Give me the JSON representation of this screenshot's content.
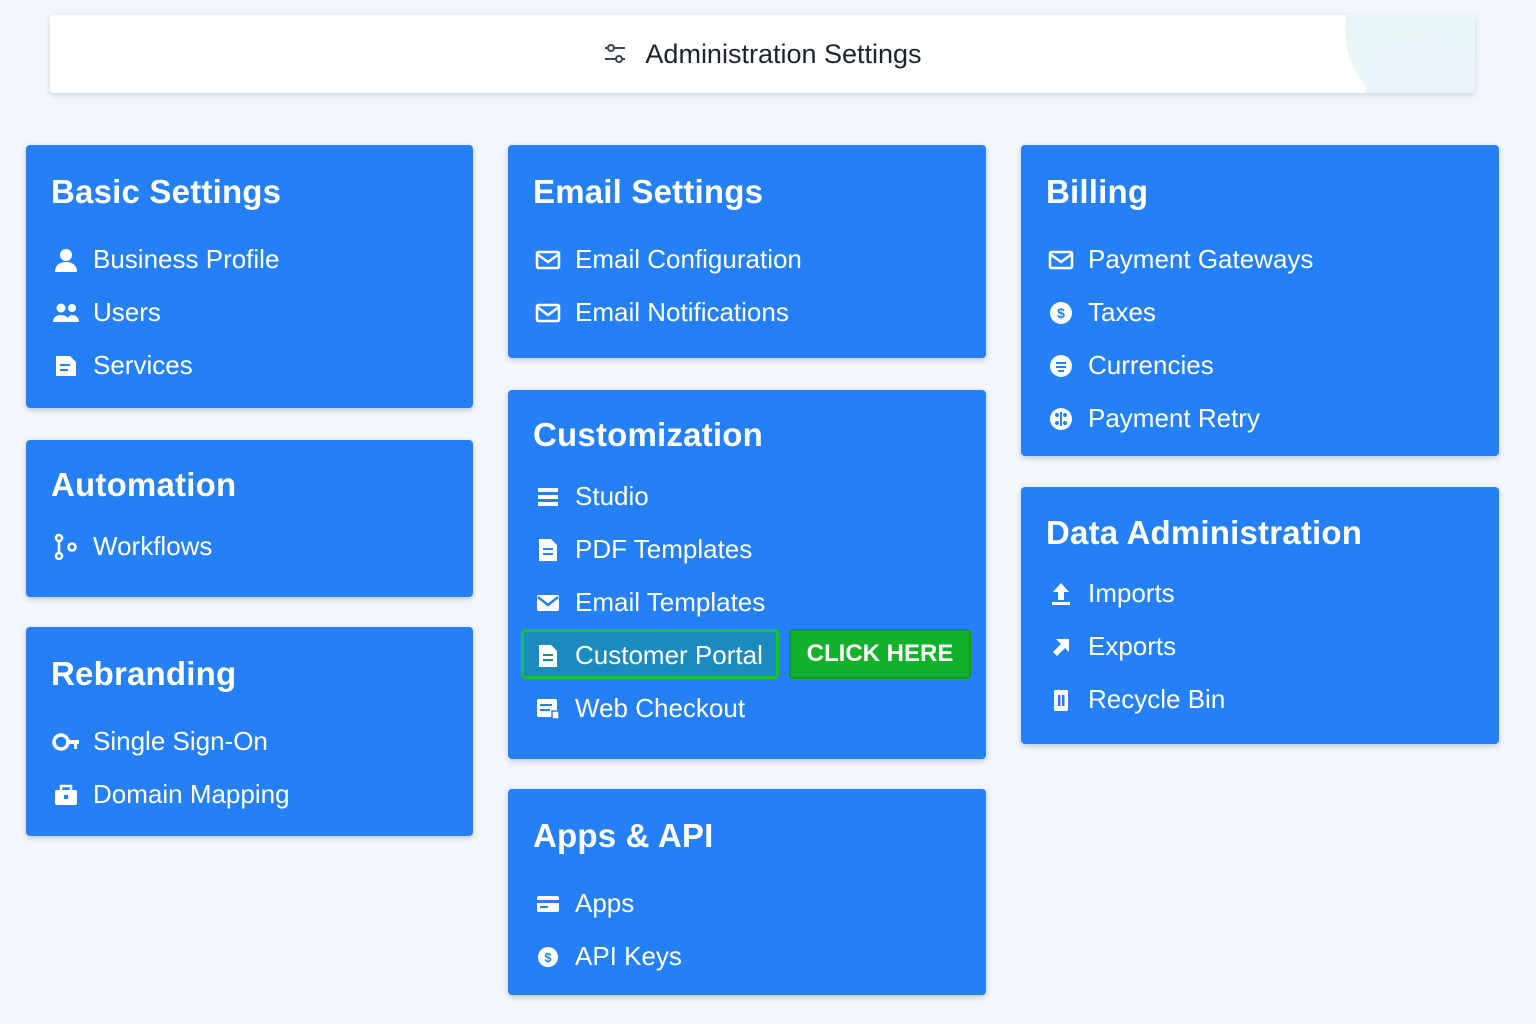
{
  "header": {
    "title": "Administration Settings",
    "icon": "sliders-icon"
  },
  "cards": {
    "basic": {
      "title": "Basic Settings",
      "items": [
        {
          "label": "Business Profile",
          "icon": "user-icon"
        },
        {
          "label": "Users",
          "icon": "users-icon"
        },
        {
          "label": "Services",
          "icon": "document-icon"
        }
      ]
    },
    "automation": {
      "title": "Automation",
      "items": [
        {
          "label": "Workflows",
          "icon": "workflow-icon"
        }
      ]
    },
    "rebranding": {
      "title": "Rebranding",
      "items": [
        {
          "label": "Single Sign-On",
          "icon": "key-icon"
        },
        {
          "label": "Domain Mapping",
          "icon": "briefcase-icon"
        }
      ]
    },
    "email": {
      "title": "Email Settings",
      "items": [
        {
          "label": "Email Configuration",
          "icon": "envelope-icon"
        },
        {
          "label": "Email Notifications",
          "icon": "envelope-icon"
        }
      ]
    },
    "customization": {
      "title": "Customization",
      "items": [
        {
          "label": "Studio",
          "icon": "list-icon"
        },
        {
          "label": "PDF Templates",
          "icon": "file-icon"
        },
        {
          "label": "Email Templates",
          "icon": "mail-icon"
        },
        {
          "label": "Customer Portal",
          "icon": "file-icon"
        },
        {
          "label": "Web Checkout",
          "icon": "checkout-icon"
        }
      ],
      "click_here": "CLICK HERE"
    },
    "apps": {
      "title": "Apps & API",
      "items": [
        {
          "label": "Apps",
          "icon": "card-icon"
        },
        {
          "label": "API Keys",
          "icon": "coin-icon"
        }
      ]
    },
    "billing": {
      "title": "Billing",
      "items": [
        {
          "label": "Payment Gateways",
          "icon": "envelope-icon"
        },
        {
          "label": "Taxes",
          "icon": "dollar-coin-icon"
        },
        {
          "label": "Currencies",
          "icon": "currency-icon"
        },
        {
          "label": "Payment Retry",
          "icon": "retry-icon"
        }
      ]
    },
    "data": {
      "title": "Data Administration",
      "items": [
        {
          "label": "Imports",
          "icon": "upload-icon"
        },
        {
          "label": "Exports",
          "icon": "arrow-up-right-icon"
        },
        {
          "label": "Recycle Bin",
          "icon": "trash-icon"
        }
      ]
    }
  },
  "colors": {
    "card": "#2680f5",
    "highlight": "#18c13a",
    "button": "#12b12b",
    "background": "#f3f6fb"
  }
}
